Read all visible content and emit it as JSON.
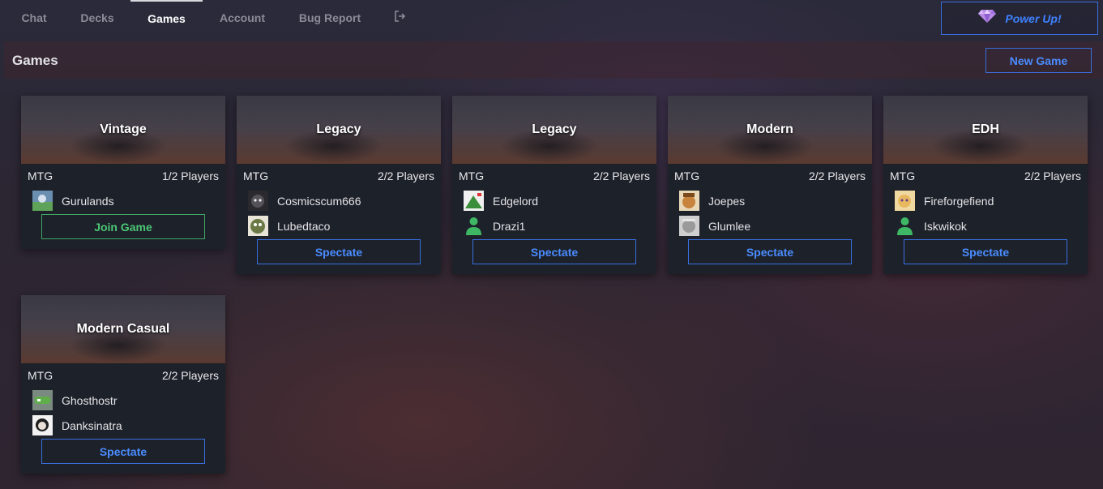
{
  "nav": {
    "tabs": [
      {
        "label": "Chat",
        "active": false
      },
      {
        "label": "Decks",
        "active": false
      },
      {
        "label": "Games",
        "active": true
      },
      {
        "label": "Account",
        "active": false
      },
      {
        "label": "Bug Report",
        "active": false
      }
    ],
    "logout_icon": "logout-icon"
  },
  "powerup": {
    "label": "Power Up!",
    "icon": "gem-icon"
  },
  "header": {
    "title": "Games",
    "new_game_label": "New Game"
  },
  "colors": {
    "accent_blue": "#3e82ff",
    "join_green": "#4cc776",
    "card_bg": "#1d2129"
  },
  "games": [
    {
      "title": "Vintage",
      "game": "MTG",
      "players_count": "1/2 Players",
      "players": [
        {
          "name": "Gurulands",
          "avatar": "gurulands-avatar"
        }
      ],
      "action": "Join Game"
    },
    {
      "title": "Legacy",
      "game": "MTG",
      "players_count": "2/2 Players",
      "players": [
        {
          "name": "Cosmicscum666",
          "avatar": "cosmicscum-avatar"
        },
        {
          "name": "Lubedtaco",
          "avatar": "lubedtaco-avatar"
        }
      ],
      "action": "Spectate"
    },
    {
      "title": "Legacy",
      "game": "MTG",
      "players_count": "2/2 Players",
      "players": [
        {
          "name": "Edgelord",
          "avatar": "edgelord-avatar"
        },
        {
          "name": "Drazi1",
          "avatar": "default-user-icon"
        }
      ],
      "action": "Spectate"
    },
    {
      "title": "Modern",
      "game": "MTG",
      "players_count": "2/2 Players",
      "players": [
        {
          "name": "Joepes",
          "avatar": "joepes-avatar"
        },
        {
          "name": "Glumlee",
          "avatar": "glumlee-avatar"
        }
      ],
      "action": "Spectate"
    },
    {
      "title": "EDH",
      "game": "MTG",
      "players_count": "2/2 Players",
      "players": [
        {
          "name": "Fireforgefiend",
          "avatar": "fireforgefiend-avatar"
        },
        {
          "name": "Iskwikok",
          "avatar": "default-user-icon"
        }
      ],
      "action": "Spectate"
    },
    {
      "title": "Modern Casual",
      "game": "MTG",
      "players_count": "2/2 Players",
      "players": [
        {
          "name": "Ghosthostr",
          "avatar": "ghosthostr-avatar"
        },
        {
          "name": "Danksinatra",
          "avatar": "danksinatra-avatar"
        }
      ],
      "action": "Spectate"
    }
  ]
}
